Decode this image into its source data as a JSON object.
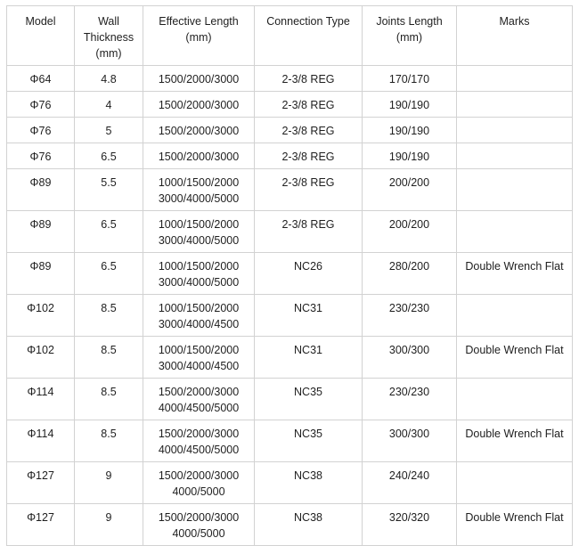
{
  "table": {
    "headers": [
      [
        "Model"
      ],
      [
        "Wall",
        "Thickness",
        "(mm)"
      ],
      [
        "Effective Length",
        "(mm)"
      ],
      [
        "Connection Type"
      ],
      [
        "Joints Length",
        "(mm)"
      ],
      [
        "Marks"
      ]
    ],
    "rows": [
      {
        "model": "Φ64",
        "wall": "4.8",
        "length": [
          "1500/2000/3000"
        ],
        "connection": "2-3/8 REG",
        "joints": "170/170",
        "marks": ""
      },
      {
        "model": "Φ76",
        "wall": "4",
        "length": [
          "1500/2000/3000"
        ],
        "connection": "2-3/8 REG",
        "joints": "190/190",
        "marks": ""
      },
      {
        "model": "Φ76",
        "wall": "5",
        "length": [
          "1500/2000/3000"
        ],
        "connection": "2-3/8 REG",
        "joints": "190/190",
        "marks": ""
      },
      {
        "model": "Φ76",
        "wall": "6.5",
        "length": [
          "1500/2000/3000"
        ],
        "connection": "2-3/8 REG",
        "joints": "190/190",
        "marks": ""
      },
      {
        "model": "Φ89",
        "wall": "5.5",
        "length": [
          "1000/1500/2000",
          "3000/4000/5000"
        ],
        "connection": "2-3/8 REG",
        "joints": "200/200",
        "marks": ""
      },
      {
        "model": "Φ89",
        "wall": "6.5",
        "length": [
          "1000/1500/2000",
          "3000/4000/5000"
        ],
        "connection": "2-3/8 REG",
        "joints": "200/200",
        "marks": ""
      },
      {
        "model": "Φ89",
        "wall": "6.5",
        "length": [
          "1000/1500/2000",
          "3000/4000/5000"
        ],
        "connection": "NC26",
        "joints": "280/200",
        "marks": "Double Wrench Flat"
      },
      {
        "model": "Φ102",
        "wall": "8.5",
        "length": [
          "1000/1500/2000",
          "3000/4000/4500"
        ],
        "connection": "NC31",
        "joints": "230/230",
        "marks": ""
      },
      {
        "model": "Φ102",
        "wall": "8.5",
        "length": [
          "1000/1500/2000",
          "3000/4000/4500"
        ],
        "connection": "NC31",
        "joints": "300/300",
        "marks": "Double Wrench Flat"
      },
      {
        "model": "Φ114",
        "wall": "8.5",
        "length": [
          "1500/2000/3000",
          "4000/4500/5000"
        ],
        "connection": "NC35",
        "joints": "230/230",
        "marks": ""
      },
      {
        "model": "Φ114",
        "wall": "8.5",
        "length": [
          "1500/2000/3000",
          "4000/4500/5000"
        ],
        "connection": "NC35",
        "joints": "300/300",
        "marks": "Double Wrench Flat"
      },
      {
        "model": "Φ127",
        "wall": "9",
        "length": [
          "1500/2000/3000",
          "4000/5000"
        ],
        "connection": "NC38",
        "joints": "240/240",
        "marks": ""
      },
      {
        "model": "Φ127",
        "wall": "9",
        "length": [
          "1500/2000/3000",
          "4000/5000"
        ],
        "connection": "NC38",
        "joints": "320/320",
        "marks": "Double Wrench Flat"
      }
    ]
  }
}
